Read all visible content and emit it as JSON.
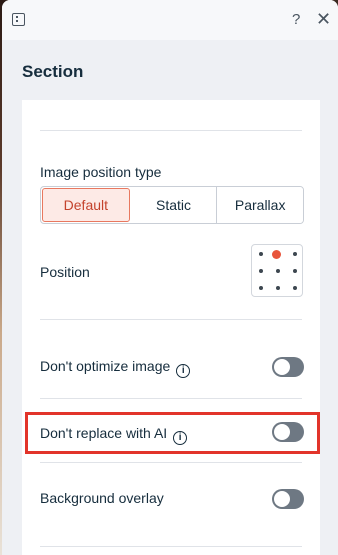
{
  "header": {
    "help_glyph": "?",
    "close_glyph": "✕"
  },
  "panel": {
    "title": "Section"
  },
  "image_position_type": {
    "label": "Image position type",
    "options": [
      "Default",
      "Static",
      "Parallax"
    ],
    "selected": "Default"
  },
  "position": {
    "label": "Position",
    "selected_cell": "top-center"
  },
  "settings": {
    "optimize": {
      "label": "Don't optimize image",
      "enabled": false
    },
    "replace_ai": {
      "label": "Don't replace with AI",
      "enabled": false
    },
    "overlay": {
      "label": "Background overlay",
      "enabled": false
    }
  },
  "colors": {
    "accent": "#e8553c",
    "highlight": "#e2342a",
    "toggle_off": "#6e7883"
  },
  "icons": [
    "panel-icon",
    "help-icon",
    "close-icon",
    "info-icon"
  ]
}
